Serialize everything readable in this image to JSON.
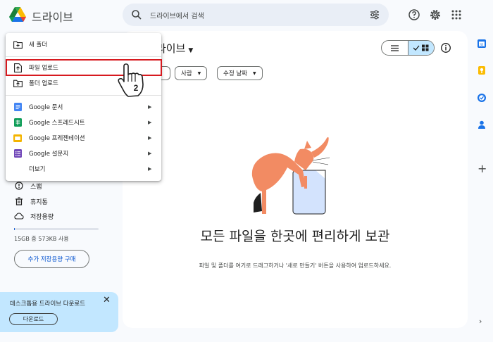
{
  "app": {
    "title": "드라이브"
  },
  "search": {
    "placeholder": "드라이브에서 검색"
  },
  "main": {
    "title": "라이브",
    "chips": [
      {
        "label": "사람"
      },
      {
        "label": "수정 날짜"
      }
    ],
    "empty_title": "모든 파일을 한곳에 편리하게 보관",
    "empty_sub": "파일 및 폴더를 여기로 드래그하거나 '새로 만들기' 버튼을 사용하여 업로드하세요."
  },
  "new_menu": {
    "items": [
      {
        "label": "새 폴더",
        "icon": "new-folder-icon"
      },
      {
        "label": "파일 업로드",
        "icon": "file-upload-icon"
      },
      {
        "label": "폴더 업로드",
        "icon": "folder-upload-icon"
      },
      {
        "label": "Google 문서",
        "icon": "google-docs-icon"
      },
      {
        "label": "Google 스프레드시트",
        "icon": "google-sheets-icon"
      },
      {
        "label": "Google 프레젠테이션",
        "icon": "google-slides-icon"
      },
      {
        "label": "Google 설문지",
        "icon": "google-forms-icon"
      },
      {
        "label": "더보기",
        "icon": ""
      }
    ],
    "step_badge": "2"
  },
  "sidebar": {
    "items": [
      {
        "label": "스팸",
        "icon": "spam-icon"
      },
      {
        "label": "휴지통",
        "icon": "trash-icon"
      },
      {
        "label": "저장용량",
        "icon": "cloud-icon"
      }
    ],
    "storage_text": "15GB 중 573KB 사용",
    "storage_fraction": 4e-05,
    "buy_storage": "추가 저장용량 구매"
  },
  "download_card": {
    "text": "데스크톱용 드라이브 다운로드",
    "button": "다운로드"
  },
  "colors": {
    "accent": "#0b57d0",
    "selected": "#c2e7ff",
    "highlight_box": "#d7191f",
    "illustration_cat": "#f28b63"
  }
}
